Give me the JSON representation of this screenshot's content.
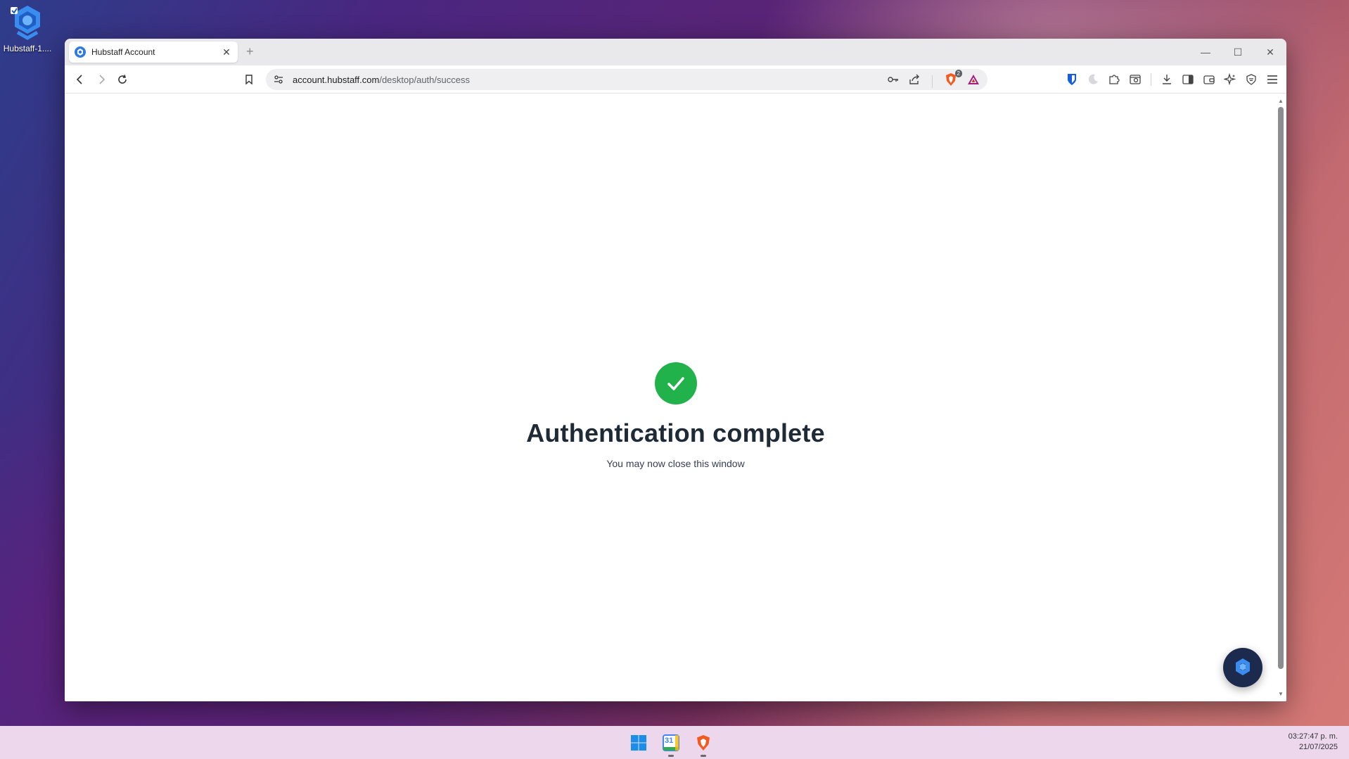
{
  "desktop": {
    "icon_label": "Hubstaff-1...."
  },
  "browser": {
    "tab_title": "Hubstaff Account",
    "url_host": "account.hubstaff.com",
    "url_path": "/desktop/auth/success",
    "shields_badge": "2"
  },
  "page": {
    "heading": "Authentication complete",
    "subtext": "You may now close this window"
  },
  "taskbar": {
    "calendar_day": "31",
    "time": "03:27:47 p. m.",
    "date": "21/07/2025"
  },
  "colors": {
    "success": "#22b24c",
    "heading": "#1f2a37",
    "hubstaff_blue": "#2f7be0",
    "chat_bg": "#1c2a4d"
  }
}
